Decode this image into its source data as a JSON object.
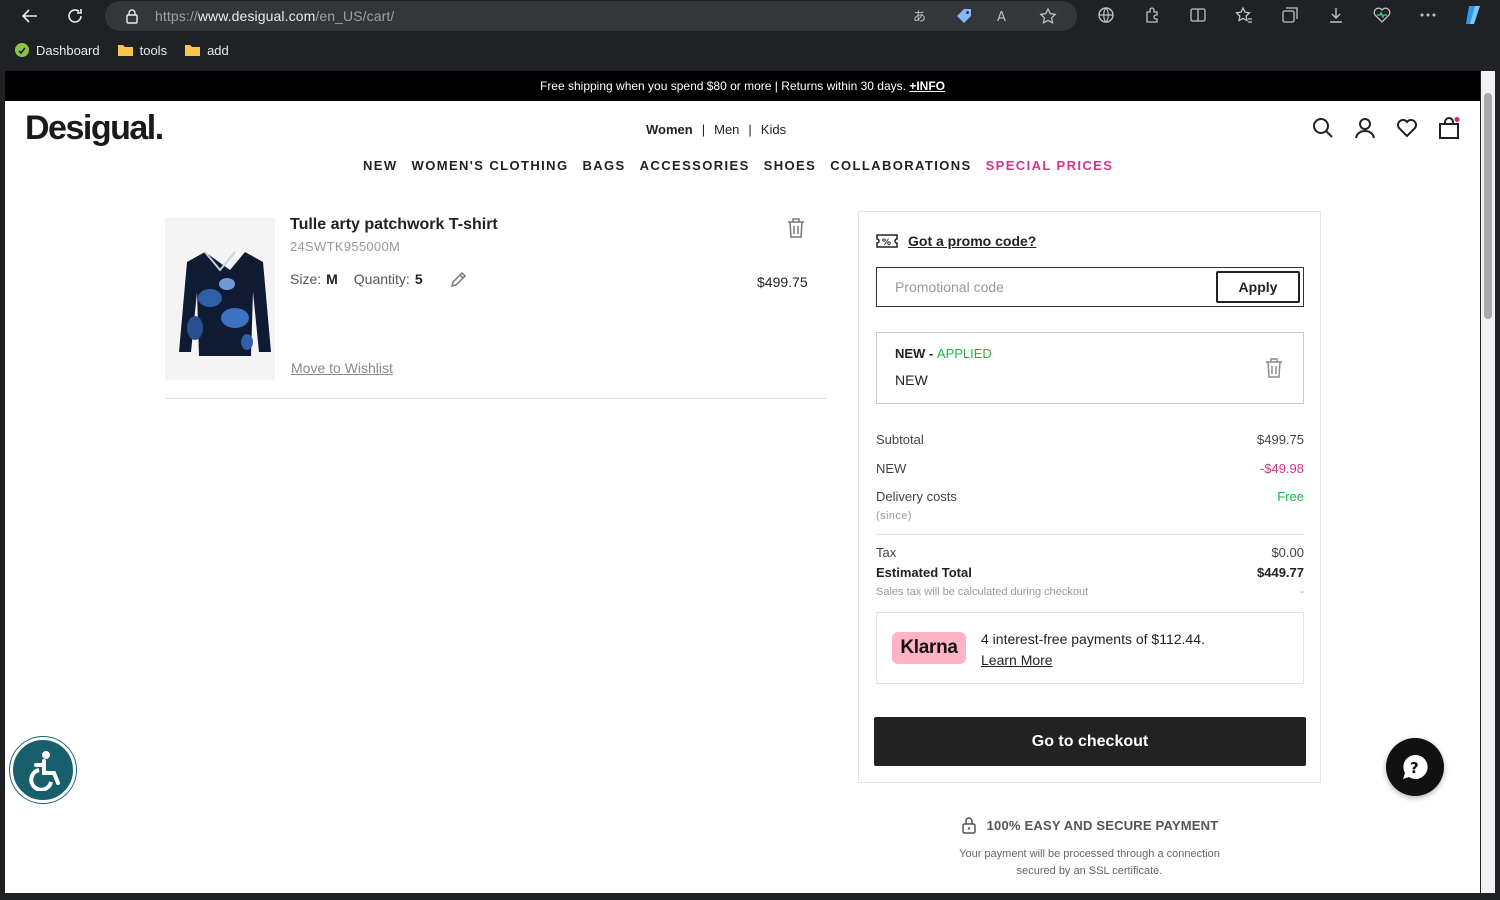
{
  "browser": {
    "url_prefix": "https://",
    "url_domain": "www.desigual.com",
    "url_path": "/en_US/cart/",
    "bookmarks": [
      "Dashboard",
      "tools",
      "add"
    ]
  },
  "promo_bar": {
    "text": "Free shipping when you spend $80 or more | Returns within 30 days.",
    "link": "+INFO"
  },
  "header": {
    "logo": "Desigual.",
    "gender_tabs": [
      "Women",
      "Men",
      "Kids"
    ],
    "nav": [
      "NEW",
      "WOMEN'S CLOTHING",
      "BAGS",
      "ACCESSORIES",
      "SHOES",
      "COLLABORATIONS",
      "SPECIAL PRICES"
    ]
  },
  "product": {
    "title": "Tulle arty patchwork T-shirt",
    "ref": "24SWTK955000M",
    "size_label": "Size:",
    "size": "M",
    "qty_label": "Quantity:",
    "qty": "5",
    "price": "$499.75",
    "wishlist": "Move to Wishlist"
  },
  "summary": {
    "promo_heading": "Got a promo code?",
    "promo_placeholder": "Promotional code",
    "apply": "Apply",
    "applied_code": "NEW",
    "applied_sep": " - ",
    "applied_status": "APPLIED",
    "applied_name": "NEW",
    "subtotal_label": "Subtotal",
    "subtotal": "$499.75",
    "discount_label": "NEW",
    "discount": "-$49.98",
    "delivery_label": "Delivery costs",
    "delivery": "Free",
    "since": "(since)",
    "tax_label": "Tax",
    "tax": "$0.00",
    "total_label": "Estimated Total",
    "total": "$449.77",
    "tax_note": "Sales tax will be calculated during checkout",
    "tax_note_value": "-",
    "klarna_logo": "Klarna",
    "klarna_text": "4 interest-free payments of $112.44.",
    "klarna_link": "Learn More",
    "checkout": "Go to checkout"
  },
  "secure": {
    "heading": "100% EASY AND SECURE PAYMENT",
    "line1": "Your payment will be processed through a connection",
    "line2": "secured by an SSL certificate."
  },
  "colors": {
    "accent_pink": "#d6338a",
    "success_green": "#1fb34a",
    "klarna_pink": "#ffb3c7",
    "accessibility_teal": "#17606b"
  }
}
